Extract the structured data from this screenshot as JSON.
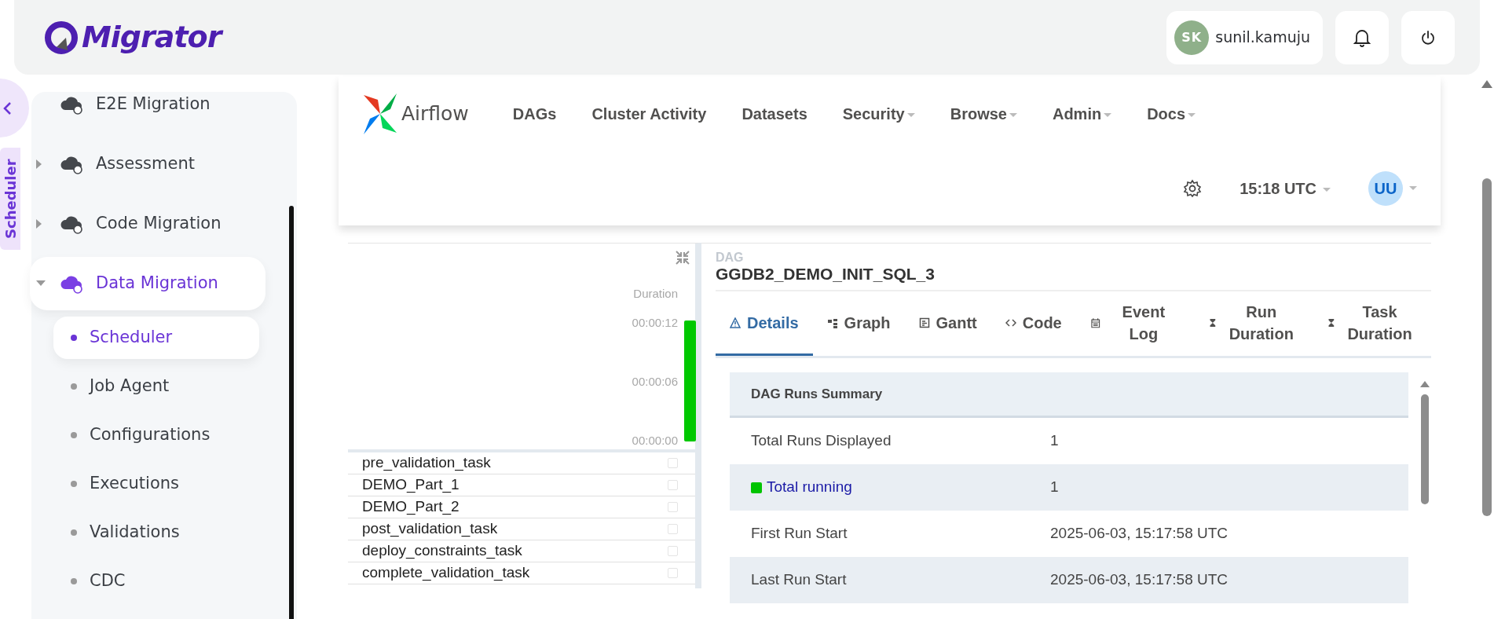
{
  "app": {
    "logo": "Migrator",
    "user": {
      "initials": "SK",
      "name": "sunil.kamuju"
    }
  },
  "side_tab": "Scheduler",
  "sidebar": {
    "items": [
      {
        "label": "E2E Migration",
        "selected": false
      },
      {
        "label": "Assessment",
        "selected": false,
        "expanded": false
      },
      {
        "label": "Code Migration",
        "selected": false,
        "expanded": false
      },
      {
        "label": "Data Migration",
        "selected": true,
        "expanded": true,
        "children": [
          {
            "label": "Scheduler",
            "selected": true
          },
          {
            "label": "Job Agent",
            "selected": false
          },
          {
            "label": "Configurations",
            "selected": false
          },
          {
            "label": "Executions",
            "selected": false
          },
          {
            "label": "Validations",
            "selected": false
          },
          {
            "label": "CDC",
            "selected": false
          }
        ]
      }
    ]
  },
  "airflow": {
    "brand": "Airflow",
    "nav": [
      {
        "label": "DAGs",
        "dropdown": false
      },
      {
        "label": "Cluster Activity",
        "dropdown": false
      },
      {
        "label": "Datasets",
        "dropdown": false
      },
      {
        "label": "Security",
        "dropdown": true
      },
      {
        "label": "Browse",
        "dropdown": true
      },
      {
        "label": "Admin",
        "dropdown": true
      },
      {
        "label": "Docs",
        "dropdown": true
      }
    ],
    "time": "15:18 UTC",
    "user_initials": "UU"
  },
  "grid": {
    "duration_title": "Duration",
    "duration_ticks": [
      "00:00:12",
      "00:00:06",
      "00:00:00"
    ],
    "run_bar": {
      "level": 1
    },
    "tasks": [
      "pre_validation_task",
      "DEMO_Part_1",
      "DEMO_Part_2",
      "post_validation_task",
      "deploy_constraints_task",
      "complete_validation_task"
    ]
  },
  "details": {
    "caption": "DAG",
    "dag_id": "GGDB2_DEMO_INIT_SQL_3",
    "tabs": [
      {
        "label": "Details",
        "kind": "warning",
        "selected": true
      },
      {
        "label": "Graph",
        "kind": "graph",
        "selected": false
      },
      {
        "label": "Gantt",
        "kind": "gantt",
        "selected": false
      },
      {
        "label": "Code",
        "kind": "code",
        "selected": false
      },
      {
        "label": "Event Log",
        "kind": "calendar",
        "selected": false
      },
      {
        "label": "Run Duration",
        "kind": "hourglass",
        "selected": false
      },
      {
        "label": "Task Duration",
        "kind": "hourglass",
        "selected": false
      }
    ],
    "table": {
      "title": "DAG Runs Summary",
      "rows": [
        {
          "label": "Total Runs Displayed",
          "value": "1",
          "kind": "plain"
        },
        {
          "label": "Total running",
          "value": "1",
          "kind": "state",
          "color": "#00c400"
        },
        {
          "label": "First Run Start",
          "value": "2025-06-03, 15:17:58 UTC",
          "kind": "plain"
        },
        {
          "label": "Last Run Start",
          "value": "2025-06-03, 15:17:58 UTC",
          "kind": "plain"
        }
      ]
    }
  }
}
